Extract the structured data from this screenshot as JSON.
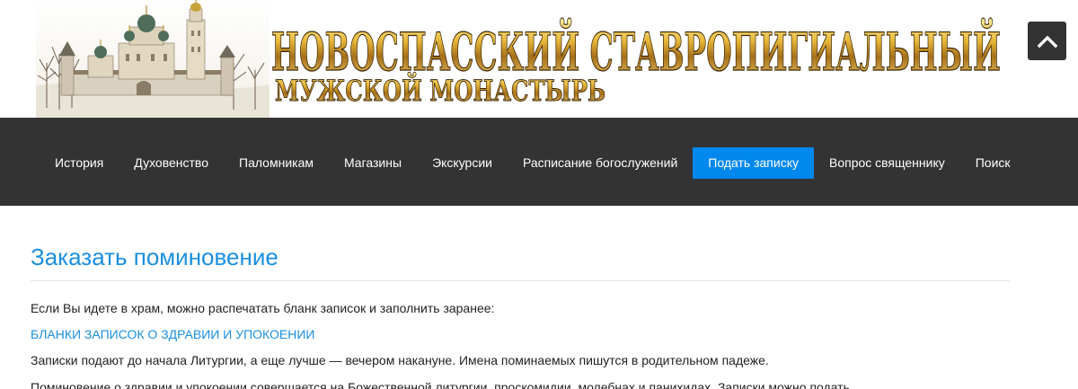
{
  "header": {
    "banner": {
      "line1": "НОВОСПАССКИЙ СТАВРОПИГИАЛЬНЫЙ",
      "line2": "МУЖСКОЙ МОНАСТЫРЬ"
    },
    "scroll_top_icon": "chevron-up-icon"
  },
  "nav": {
    "items": [
      {
        "label": "История"
      },
      {
        "label": "Духовенство"
      },
      {
        "label": "Паломникам"
      },
      {
        "label": "Магазины"
      },
      {
        "label": "Экскурсии"
      },
      {
        "label": "Расписание богослужений"
      },
      {
        "label": "Подать записку",
        "active": true
      },
      {
        "label": "Вопрос священнику"
      },
      {
        "label": "Поиск"
      }
    ]
  },
  "main": {
    "title": "Заказать поминовение",
    "intro": "Если Вы идете в храм, можно распечатать бланк записок и заполнить заранее:",
    "forms_link": "БЛАНКИ ЗАПИСОК О ЗДРАВИИ И УПОКОЕНИИ",
    "deadline_text": "Записки подают до начала Литургии, а еще лучше — вечером накануне. Имена поминаемых пишутся в родительном падеже.",
    "next_text": "Поминовение о здравии и упокоении совершается на Божественной литургии, проскомидии, молебнах и панихидах. Записки можно подать"
  },
  "colors": {
    "nav_bg": "#333333",
    "active_bg": "#0088ee",
    "accent": "#1a8fe0",
    "gold": "#d9a82a"
  }
}
